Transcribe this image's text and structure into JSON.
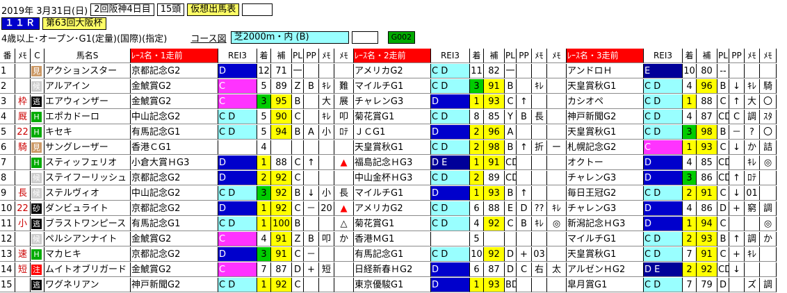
{
  "header": {
    "date": "2019年 3月31日(日)",
    "meeting": "2回阪神4日目",
    "runners": "15頭",
    "mode": "仮想出馬表",
    "race_no": "１１Ｒ",
    "race_name": "第63回大阪杯",
    "conditions": "4歳以上･オープン･G1(定量)(国際)(指定)",
    "course_label": "コース図",
    "course": "芝2000m・内 (B)",
    "code": "G002"
  },
  "columns": [
    "番",
    "ﾒﾓ",
    "C",
    "馬名S",
    "ﾚｰｽ名・1走前",
    "REI3",
    "着",
    "補",
    "PL",
    "PP",
    "ﾒﾓ",
    "ﾒﾓ",
    "ﾚｰｽ名・2走前",
    "REI3",
    "着",
    "補",
    "PL",
    "PP",
    "ﾒﾓ",
    "ﾒﾓ",
    "ﾚｰｽ名・3走前",
    "REI3",
    "着",
    "補",
    "PL",
    "PP",
    "ﾒﾓ",
    "ﾒﾓ"
  ],
  "colors": {
    "red": "#ff0000",
    "blue": "#0000cc",
    "cyan": "#99ffff",
    "magenta": "#ff33ff",
    "green": "#00cc00",
    "yellow": "#ffff00",
    "navy": "#000099"
  },
  "horses": [
    {
      "no": "1",
      "memo": "",
      "c": "",
      "tag": "見",
      "tagc": "t-brown",
      "name": "アクションスター",
      "r": [
        {
          "race": "京都記念G2",
          "rei": "D",
          "reic": "blue",
          "rank": "12",
          "rankc": "",
          "ho": "71",
          "hoc": "",
          "pl": "一",
          "pp": "",
          "m1": "",
          "m2": ""
        },
        {
          "race": "アメリカG2",
          "rei": "C D",
          "reic": "cyan",
          "rank": "11",
          "rankc": "",
          "ho": "82",
          "hoc": "",
          "pl": "一",
          "pp": "",
          "m1": "",
          "m2": ""
        },
        {
          "race": "アンドロＨ",
          "rei": "E",
          "reic": "navy",
          "rank": "10",
          "rankc": "",
          "ho": "80",
          "hoc": "",
          "pl": "--",
          "pp": "",
          "m1": "",
          "m2": ""
        }
      ]
    },
    {
      "no": "2",
      "memo": "",
      "c": "",
      "tag": "候",
      "tagc": "t-gray",
      "name": "アルアイン",
      "r": [
        {
          "race": "金鯱賞G2",
          "rei": "C",
          "reic": "magenta",
          "rank": "5",
          "rankc": "",
          "ho": "89",
          "hoc": "",
          "pl": "Z",
          "pp": "B",
          "m1": "ｷﾚ",
          "m2": "難"
        },
        {
          "race": "マイルチG1",
          "rei": "C D",
          "reic": "cyan",
          "rank": "3",
          "rankc": "green",
          "ho": "91",
          "hoc": "yellow",
          "pl": "B",
          "pp": "",
          "m1": "ｷﾚ",
          "m2": ""
        },
        {
          "race": "天皇賞秋G1",
          "rei": "C D",
          "reic": "cyan",
          "rank": "4",
          "rankc": "",
          "ho": "96",
          "hoc": "yellow",
          "pl": "B",
          "pp": "↓",
          "m1": "ｷﾚ",
          "m2": "騎"
        }
      ]
    },
    {
      "no": "3",
      "memo": "枠",
      "c": "",
      "tag": "逃",
      "tagc": "t-black",
      "name": "エアウィンザー",
      "r": [
        {
          "race": "金鯱賞G2",
          "rei": "C",
          "reic": "magenta",
          "rank": "3",
          "rankc": "green",
          "ho": "95",
          "hoc": "yellow",
          "pl": "B",
          "pp": "",
          "m1": "大",
          "m2": "展"
        },
        {
          "race": "チャレンG3",
          "rei": "D",
          "reic": "blue",
          "rank": "1",
          "rankc": "yellow",
          "ho": "93",
          "hoc": "yellow",
          "pl": "C",
          "pp": "↑",
          "m1": "",
          "m2": ""
        },
        {
          "race": "カシオペ",
          "rei": "C D",
          "reic": "cyan",
          "rank": "1",
          "rankc": "yellow",
          "ho": "88",
          "hoc": "",
          "pl": "C",
          "pp": "↑",
          "m1": "大",
          "m2": "〇"
        }
      ]
    },
    {
      "no": "4",
      "memo": "厩",
      "c": "",
      "tag": "H",
      "tagc": "t-green",
      "name": "エポカドーロ",
      "r": [
        {
          "race": "中山記念G2",
          "rei": "C D",
          "reic": "cyan",
          "rank": "5",
          "rankc": "",
          "ho": "90",
          "hoc": "yellow",
          "pl": "C",
          "pp": "",
          "m1": "ｷﾚ",
          "m2": "叩"
        },
        {
          "race": "菊花賞G1",
          "rei": "C D",
          "reic": "cyan",
          "rank": "8",
          "rankc": "",
          "ho": "85",
          "hoc": "",
          "pl": "Y",
          "pp": "B",
          "m1": "長",
          "m2": ""
        },
        {
          "race": "神戸新聞G2",
          "rei": "C D",
          "reic": "cyan",
          "rank": "4",
          "rankc": "",
          "ho": "87",
          "hoc": "",
          "pl": "CD",
          "pp": "C",
          "m1": "調",
          "m2": "ｽﾀ"
        }
      ]
    },
    {
      "no": "5",
      "memo": "22",
      "c": "",
      "tag": "H",
      "tagc": "t-green",
      "name": "キセキ",
      "r": [
        {
          "race": "有馬記念G1",
          "rei": "C D",
          "reic": "cyan",
          "rank": "5",
          "rankc": "",
          "ho": "94",
          "hoc": "yellow",
          "pl": "B",
          "pp": "A",
          "m1": "小",
          "m2": "ﾛﾃ"
        },
        {
          "race": "ＪＣG1",
          "rei": "D",
          "reic": "blue",
          "rank": "2",
          "rankc": "yellow",
          "ho": "96",
          "hoc": "yellow",
          "pl": "A",
          "pp": "",
          "m1": "",
          "m2": ""
        },
        {
          "race": "天皇賞秋G1",
          "rei": "C D",
          "reic": "cyan",
          "rank": "3",
          "rankc": "green",
          "ho": "98",
          "hoc": "yellow",
          "pl": "B",
          "pp": "－",
          "m1": "?",
          "m2": "〇"
        }
      ]
    },
    {
      "no": "6",
      "memo": "騎",
      "c": "",
      "tag": "見",
      "tagc": "t-brown",
      "name": "サングレーザー",
      "r": [
        {
          "race": "香港ＣG1",
          "rei": "",
          "reic": "",
          "rank": "4",
          "rankc": "",
          "ho": "",
          "hoc": "",
          "pl": "",
          "pp": "",
          "m1": "",
          "m2": ""
        },
        {
          "race": "天皇賞秋G1",
          "rei": "C D",
          "reic": "cyan",
          "rank": "2",
          "rankc": "yellow",
          "ho": "98",
          "hoc": "yellow",
          "pl": "B",
          "pp": "↑",
          "m1": "折",
          "m2": "ー"
        },
        {
          "race": "札幌記念G2",
          "rei": "C",
          "reic": "magenta",
          "rank": "1",
          "rankc": "yellow",
          "ho": "93",
          "hoc": "yellow",
          "pl": "C",
          "pp": "↓",
          "m1": "か",
          "m2": "詰"
        }
      ]
    },
    {
      "no": "7",
      "memo": "",
      "c": "",
      "tag": "H",
      "tagc": "t-green",
      "name": "スティッフェリオ",
      "r": [
        {
          "race": "小倉大賞ＨG3",
          "rei": "D",
          "reic": "blue",
          "rank": "1",
          "rankc": "yellow",
          "ho": "88",
          "hoc": "",
          "pl": "C",
          "pp": "↑",
          "m1": "",
          "m2": "▲"
        },
        {
          "race": "福島記念ＨG3",
          "rei": "D E",
          "reic": "navy",
          "rank": "1",
          "rankc": "yellow",
          "ho": "91",
          "hoc": "yellow",
          "pl": "CD",
          "pp": "",
          "m1": "",
          "m2": ""
        },
        {
          "race": "オクトー",
          "rei": "D",
          "reic": "blue",
          "rank": "4",
          "rankc": "",
          "ho": "85",
          "hoc": "",
          "pl": "CD",
          "pp": "",
          "m1": "ｷﾚ",
          "m2": "◎"
        }
      ]
    },
    {
      "no": "8",
      "memo": "",
      "c": "",
      "tag": "候",
      "tagc": "t-gray",
      "name": "ステイフーリッシュ",
      "r": [
        {
          "race": "京都記念G2",
          "rei": "D",
          "reic": "blue",
          "rank": "2",
          "rankc": "yellow",
          "ho": "92",
          "hoc": "yellow",
          "pl": "C",
          "pp": "",
          "m1": "",
          "m2": ""
        },
        {
          "race": "中山金杯ＨG3",
          "rei": "C D",
          "reic": "cyan",
          "rank": "2",
          "rankc": "yellow",
          "ho": "89",
          "hoc": "",
          "pl": "CD",
          "pp": "",
          "m1": "",
          "m2": ""
        },
        {
          "race": "チャレンG3",
          "rei": "D",
          "reic": "blue",
          "rank": "3",
          "rankc": "green",
          "ho": "86",
          "hoc": "",
          "pl": "CD",
          "pp": "↑",
          "m1": "ﾛﾃ",
          "m2": ""
        }
      ]
    },
    {
      "no": "9",
      "memo": "長",
      "c": "",
      "tag": "候",
      "tagc": "t-gray",
      "name": "ステルヴィオ",
      "r": [
        {
          "race": "中山記念G2",
          "rei": "C D",
          "reic": "cyan",
          "rank": "3",
          "rankc": "green",
          "ho": "92",
          "hoc": "yellow",
          "pl": "B",
          "pp": "↓",
          "m1": "小",
          "m2": "長"
        },
        {
          "race": "マイルチG1",
          "rei": "D",
          "reic": "blue",
          "rank": "1",
          "rankc": "yellow",
          "ho": "93",
          "hoc": "yellow",
          "pl": "B",
          "pp": "↑",
          "m1": "",
          "m2": ""
        },
        {
          "race": "毎日王冠G2",
          "rei": "C D",
          "reic": "cyan",
          "rank": "2",
          "rankc": "yellow",
          "ho": "91",
          "hoc": "yellow",
          "pl": "C",
          "pp": "↓",
          "m1": "01",
          "m2": ""
        }
      ]
    },
    {
      "no": "10",
      "memo": "22",
      "c": "",
      "tag": "砂",
      "tagc": "t-black",
      "name": "ダンビュライト",
      "r": [
        {
          "race": "京都記念G2",
          "rei": "D",
          "reic": "blue",
          "rank": "1",
          "rankc": "yellow",
          "ho": "92",
          "hoc": "yellow",
          "pl": "C",
          "pp": "－",
          "m1": "20",
          "m2": "▲"
        },
        {
          "race": "アメリカG2",
          "rei": "C D",
          "reic": "cyan",
          "rank": "6",
          "rankc": "",
          "ho": "88",
          "hoc": "",
          "pl": "E",
          "pp": "D",
          "m1": "??",
          "m2": "ｷﾚ"
        },
        {
          "race": "チャレンG3",
          "rei": "D",
          "reic": "blue",
          "rank": "4",
          "rankc": "",
          "ho": "86",
          "hoc": "",
          "pl": "D",
          "pp": "+",
          "m1": "窮",
          "m2": "調"
        }
      ]
    },
    {
      "no": "11",
      "memo": "小",
      "c": "",
      "tag": "逃",
      "tagc": "t-black",
      "name": "ブラストワンピース",
      "r": [
        {
          "race": "有馬記念G1",
          "rei": "C D",
          "reic": "cyan",
          "rank": "1",
          "rankc": "yellow",
          "ho": "100",
          "hoc": "yellow",
          "pl": "B",
          "pp": "",
          "m1": "",
          "m2": "△"
        },
        {
          "race": "菊花賞G1",
          "rei": "C D",
          "reic": "cyan",
          "rank": "4",
          "rankc": "",
          "ho": "92",
          "hoc": "yellow",
          "pl": "C",
          "pp": "B",
          "m1": "ｷﾚ",
          "m2": "◎"
        },
        {
          "race": "新潟記念ＨG3",
          "rei": "D",
          "reic": "blue",
          "rank": "1",
          "rankc": "yellow",
          "ho": "94",
          "hoc": "yellow",
          "pl": "C",
          "pp": "",
          "m1": "",
          "m2": "◎"
        }
      ]
    },
    {
      "no": "12",
      "memo": "",
      "c": "",
      "tag": "候",
      "tagc": "t-gray",
      "name": "ペルシアンナイト",
      "r": [
        {
          "race": "金鯱賞G2",
          "rei": "C",
          "reic": "magenta",
          "rank": "4",
          "rankc": "",
          "ho": "91",
          "hoc": "yellow",
          "pl": "Z",
          "pp": "B",
          "m1": "叩",
          "m2": "か"
        },
        {
          "race": "香港ＭG1",
          "rei": "",
          "reic": "",
          "rank": "5",
          "rankc": "",
          "ho": "",
          "hoc": "",
          "pl": "",
          "pp": "",
          "m1": "",
          "m2": ""
        },
        {
          "race": "マイルチG1",
          "rei": "C D",
          "reic": "cyan",
          "rank": "2",
          "rankc": "yellow",
          "ho": "93",
          "hoc": "yellow",
          "pl": "B",
          "pp": "↑",
          "m1": "調",
          "m2": "か"
        }
      ]
    },
    {
      "no": "13",
      "memo": "速",
      "c": "",
      "tag": "H",
      "tagc": "t-green",
      "name": "マカヒキ",
      "r": [
        {
          "race": "京都記念G2",
          "rei": "D",
          "reic": "blue",
          "rank": "3",
          "rankc": "green",
          "ho": "91",
          "hoc": "yellow",
          "pl": "C",
          "pp": "－",
          "m1": "",
          "m2": ""
        },
        {
          "race": "有馬記念G1",
          "rei": "C D",
          "reic": "cyan",
          "rank": "10",
          "rankc": "",
          "ho": "92",
          "hoc": "yellow",
          "pl": "D",
          "pp": "+",
          "m1": "03",
          "m2": ""
        },
        {
          "race": "天皇賞秋G1",
          "rei": "C D",
          "reic": "cyan",
          "rank": "7",
          "rankc": "",
          "ho": "91",
          "hoc": "yellow",
          "pl": "C",
          "pp": "+",
          "m1": "ｷﾚ",
          "m2": ""
        }
      ]
    },
    {
      "no": "14",
      "memo": "短",
      "c": "",
      "tag": "注",
      "tagc": "t-red",
      "name": "ムイトオブリガード",
      "r": [
        {
          "race": "金鯱賞G2",
          "rei": "C",
          "reic": "magenta",
          "rank": "7",
          "rankc": "",
          "ho": "87",
          "hoc": "",
          "pl": "D",
          "pp": "+",
          "m1": "短",
          "m2": ""
        },
        {
          "race": "日経新春ＨG2",
          "rei": "D",
          "reic": "blue",
          "rank": "6",
          "rankc": "",
          "ho": "87",
          "hoc": "",
          "pl": "D",
          "pp": "C",
          "m1": "右",
          "m2": "太"
        },
        {
          "race": "アルゼンＨG2",
          "rei": "D E",
          "reic": "navy",
          "rank": "2",
          "rankc": "yellow",
          "ho": "92",
          "hoc": "yellow",
          "pl": "CD",
          "pp": "↓",
          "m1": "",
          "m2": ""
        }
      ]
    },
    {
      "no": "15",
      "memo": "",
      "c": "",
      "tag": "逃",
      "tagc": "t-black",
      "name": "ワグネリアン",
      "r": [
        {
          "race": "神戸新聞G2",
          "rei": "C D",
          "reic": "cyan",
          "rank": "1",
          "rankc": "yellow",
          "ho": "92",
          "hoc": "yellow",
          "pl": "C",
          "pp": "",
          "m1": "",
          "m2": ""
        },
        {
          "race": "東京優駿G1",
          "rei": "D",
          "reic": "blue",
          "rank": "1",
          "rankc": "yellow",
          "ho": "93",
          "hoc": "yellow",
          "pl": "BD",
          "pp": "",
          "m1": "",
          "m2": ""
        },
        {
          "race": "皐月賞G1",
          "rei": "C D",
          "reic": "cyan",
          "rank": "7",
          "rankc": "",
          "ho": "79",
          "hoc": "",
          "pl": "D",
          "pp": "",
          "m1": "ズ",
          "m2": "調"
        }
      ]
    }
  ]
}
